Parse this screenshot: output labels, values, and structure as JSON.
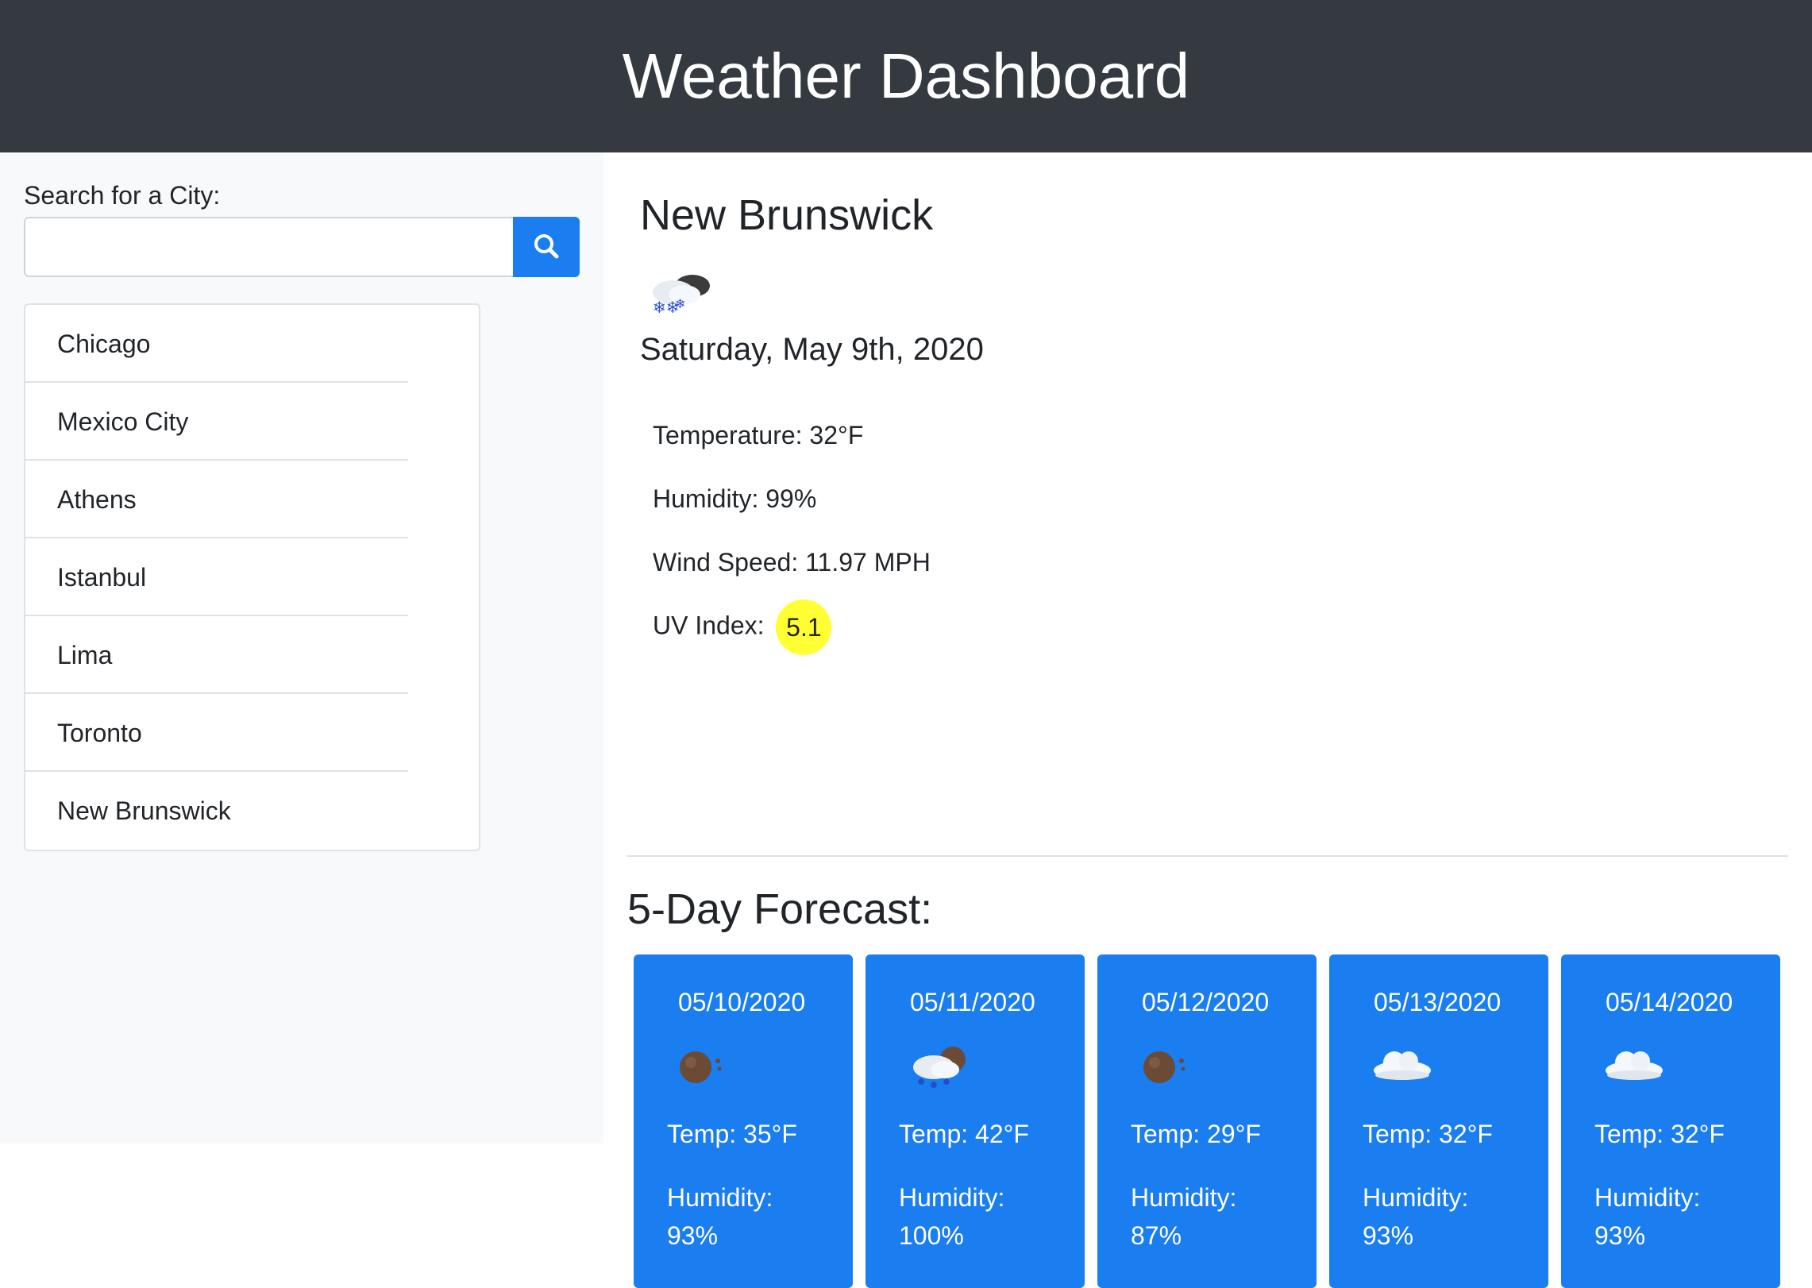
{
  "header": {
    "title": "Weather Dashboard"
  },
  "search": {
    "label": "Search for a City:",
    "value": "",
    "button_icon": "search-icon"
  },
  "history": [
    "Chicago",
    "Mexico City",
    "Athens",
    "Istanbul",
    "Lima",
    "Toronto",
    "New Brunswick"
  ],
  "current": {
    "city": "New Brunswick",
    "icon": "snow-cloud-icon",
    "date": "Saturday, May 9th, 2020",
    "temperature": "Temperature: 32°F",
    "humidity": "Humidity: 99%",
    "wind": "Wind Speed: 11.97 MPH",
    "uv_label": "UV Index:",
    "uv_value": "5.1",
    "uv_color": "#ffff33"
  },
  "forecast": {
    "title": "5-Day Forecast:",
    "accent": "#1a7df0",
    "days": [
      {
        "date": "05/10/2020",
        "icon": "overcast-icon",
        "temp": "Temp: 35°F",
        "humidity_label": "Humidity:",
        "humidity": "93%"
      },
      {
        "date": "05/11/2020",
        "icon": "rain-cloud-icon",
        "temp": "Temp: 42°F",
        "humidity_label": "Humidity:",
        "humidity": "100%"
      },
      {
        "date": "05/12/2020",
        "icon": "overcast-icon",
        "temp": "Temp: 29°F",
        "humidity_label": "Humidity:",
        "humidity": "87%"
      },
      {
        "date": "05/13/2020",
        "icon": "cloud-icon",
        "temp": "Temp: 32°F",
        "humidity_label": "Humidity:",
        "humidity": "93%"
      },
      {
        "date": "05/14/2020",
        "icon": "cloud-icon",
        "temp": "Temp: 32°F",
        "humidity_label": "Humidity:",
        "humidity": "93%"
      }
    ]
  }
}
